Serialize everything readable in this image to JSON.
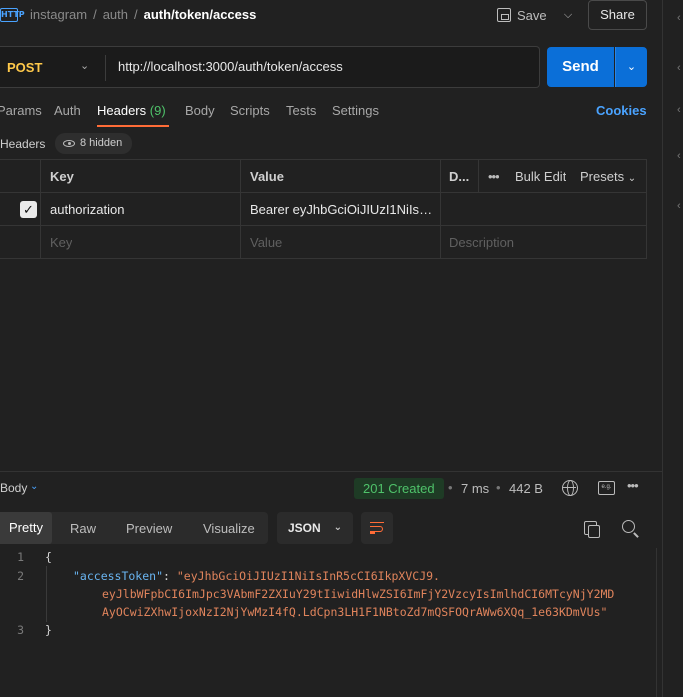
{
  "topbar": {
    "icon_text": "HTTP",
    "breadcrumb": [
      "instagram",
      "auth",
      "auth/token/access"
    ],
    "save_label": "Save",
    "share_label": "Share"
  },
  "request": {
    "method": "POST",
    "url": "http://localhost:3000/auth/token/access",
    "send_label": "Send"
  },
  "tabs": [
    {
      "label": "Params"
    },
    {
      "label": "Auth"
    },
    {
      "label": "Headers",
      "count": "(9)",
      "active": true
    },
    {
      "label": "Body"
    },
    {
      "label": "Scripts"
    },
    {
      "label": "Tests"
    },
    {
      "label": "Settings"
    }
  ],
  "cookies_label": "Cookies",
  "headers_section": {
    "label": "Headers",
    "hidden_label": "8 hidden"
  },
  "headers_table": {
    "columns": [
      "Key",
      "Value",
      "D..."
    ],
    "bulk_edit": "Bulk Edit",
    "presets": "Presets",
    "rows": [
      {
        "key": "authorization",
        "value": "Bearer eyJhbGciOiJIUzI1NiIsIn...",
        "description": "",
        "checked": true
      }
    ],
    "placeholder": {
      "key": "Key",
      "value": "Value",
      "description": "Description"
    }
  },
  "response": {
    "body_label": "Body",
    "status": "201 Created",
    "time": "7 ms",
    "size": "442 B",
    "view_tabs": [
      "Pretty",
      "Raw",
      "Preview",
      "Visualize"
    ],
    "format": "JSON",
    "code_lines": [
      {
        "n": "1",
        "text": "{"
      },
      {
        "n": "2",
        "key": "\"accessToken\"",
        "value_parts": [
          "\"eyJhbGciOiJIUzI1NiIsInR5cCI6IkpXVCJ9.",
          "eyJlbWFpbCI6ImJpc3VAbmF2ZXIuY29tIiwidHlwZSI6ImFjY2VzcyIsImlhdCI6MTcyNjY2MD",
          "AyOCwiZXhwIjoxNzI2NjYwMzI4fQ.LdCpn3LH1F1NBtoZd7mQSFOQrAWw6XQq_1e63KDmVUs\""
        ]
      },
      {
        "n": "3",
        "text": "}"
      }
    ]
  },
  "colors": {
    "accent": "#ff6c37",
    "send": "#0b6fd8",
    "method_post": "#ffc94a",
    "status_ok": "#4fc26a",
    "link": "#4aa3ff"
  }
}
